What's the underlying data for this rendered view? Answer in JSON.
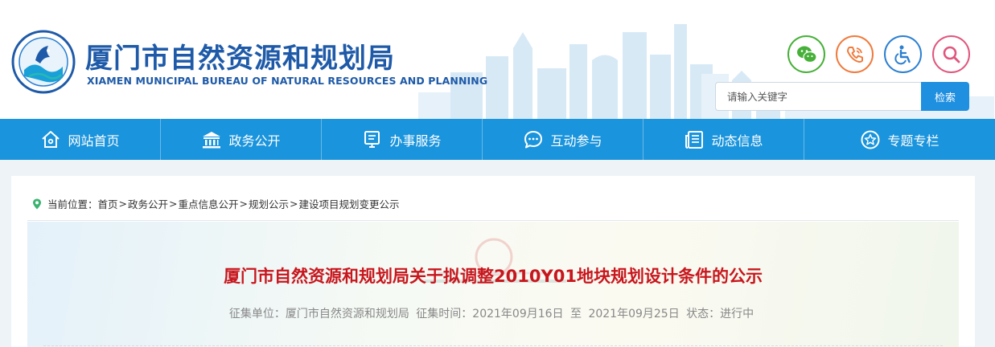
{
  "header": {
    "title_cn": "厦门市自然资源和规划局",
    "title_en": "XIAMEN MUNICIPAL BUREAU OF NATURAL RESOURCES AND PLANNING",
    "logo_icon": "bureau-seal-logo-icon",
    "quick_buttons": [
      {
        "name": "wechat",
        "icon": "wechat-icon",
        "color": "#46b038"
      },
      {
        "name": "phone",
        "icon": "phone-icon",
        "color": "#f07a3c"
      },
      {
        "name": "accessibility",
        "icon": "wheelchair-icon",
        "color": "#2b7fd1"
      },
      {
        "name": "search",
        "icon": "search-icon",
        "color": "#e0567d"
      }
    ],
    "search": {
      "placeholder": "请输入关键字",
      "button_label": "检索"
    }
  },
  "nav": {
    "items": [
      {
        "label": "网站首页",
        "icon": "home-icon"
      },
      {
        "label": "政务公开",
        "icon": "government-building-icon"
      },
      {
        "label": "办事服务",
        "icon": "monitor-icon"
      },
      {
        "label": "互动参与",
        "icon": "chat-bubble-icon"
      },
      {
        "label": "动态信息",
        "icon": "newspaper-icon"
      },
      {
        "label": "专题专栏",
        "icon": "star-icon"
      }
    ]
  },
  "breadcrumb": {
    "prefix": "当前位置：",
    "items": [
      "首页",
      "政务公开",
      "重点信息公开",
      "规划公示",
      "建设项目规划变更公示"
    ],
    "separator": ">"
  },
  "article": {
    "title": "厦门市自然资源和规划局关于拟调整2010Y01地块规划设计条件的公示",
    "collector_label": "征集单位：",
    "collector": "厦门市自然资源和规划局",
    "period_label": "征集时间：",
    "start_date": "2021年09月16日",
    "period_sep": "至",
    "end_date": "2021年09月25日",
    "status_label": "状态：",
    "status": "进行中"
  },
  "colors": {
    "brand_blue": "#1e5aa8",
    "nav_blue": "#1a94dc",
    "title_red": "#c8161d"
  }
}
